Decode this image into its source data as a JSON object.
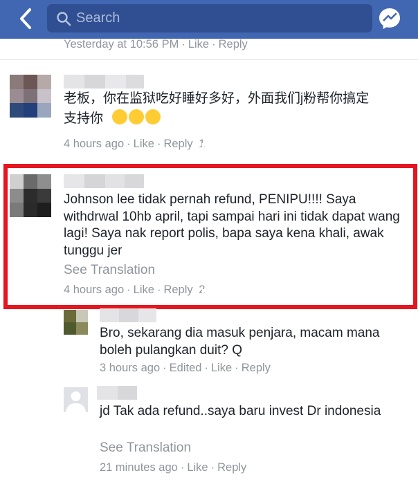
{
  "header": {
    "search_placeholder": "Search",
    "back_icon": "chevron-left-icon",
    "messenger_icon": "messenger-icon"
  },
  "prev_comment": {
    "time": "Yesterday at 10:56 PM",
    "like": "Like",
    "reply": "Reply"
  },
  "comments": [
    {
      "text_line1": "老板，你在监狱吃好睡好多好，外面我们j粉帮你搞定",
      "text_line2": "支持你",
      "time": "4 hours ago",
      "like": "Like",
      "reply": "Reply",
      "likes": "1"
    },
    {
      "text": "Johnson lee tidak pernah refund, PENIPU!!!! Saya withdrwal 10hb april, tapi sampai hari ini tidak dapat wang lagi! Saya nak report polis, bapa saya kena khali, awak tunggu jer",
      "see_translation": "See Translation",
      "time": "4 hours ago",
      "like": "Like",
      "reply": "Reply",
      "likes": "2"
    }
  ],
  "replies": [
    {
      "text": "Bro, sekarang dia masuk penjara, macam mana boleh  pulangkan duit? Q",
      "time": "3 hours ago",
      "edited": "Edited",
      "like": "Like",
      "reply": "Reply"
    },
    {
      "text": "jd Tak ada refund..saya baru invest Dr indonesia",
      "see_translation": "See Translation",
      "time": "21 minutes ago",
      "like": "Like",
      "reply": "Reply"
    }
  ],
  "colors": {
    "header": "#4267b2",
    "highlight_border": "#e5161f",
    "meta": "#90949c",
    "like_badge": "#4a80e8"
  }
}
